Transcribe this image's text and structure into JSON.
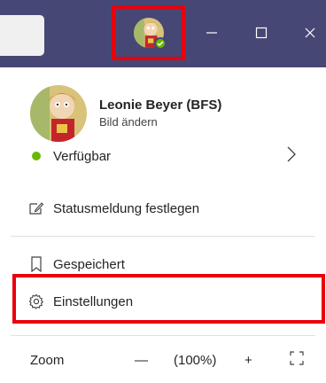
{
  "titlebar": {
    "bg_color": "#464775",
    "highlight_color": "#e8000d",
    "window_buttons": {
      "minimize": "minimize-icon",
      "maximize": "maximize-icon",
      "close": "close-icon"
    }
  },
  "profile": {
    "name": "Leonie Beyer (BFS)",
    "change_picture": "Bild ändern",
    "status_color": "#6bb700"
  },
  "menu": {
    "status_label": "Verfügbar",
    "status_message_label": "Statusmeldung festlegen",
    "saved_label": "Gespeichert",
    "settings_label": "Einstellungen"
  },
  "zoom": {
    "label": "Zoom",
    "minus": "—",
    "value": "(100%)",
    "plus": "+"
  }
}
